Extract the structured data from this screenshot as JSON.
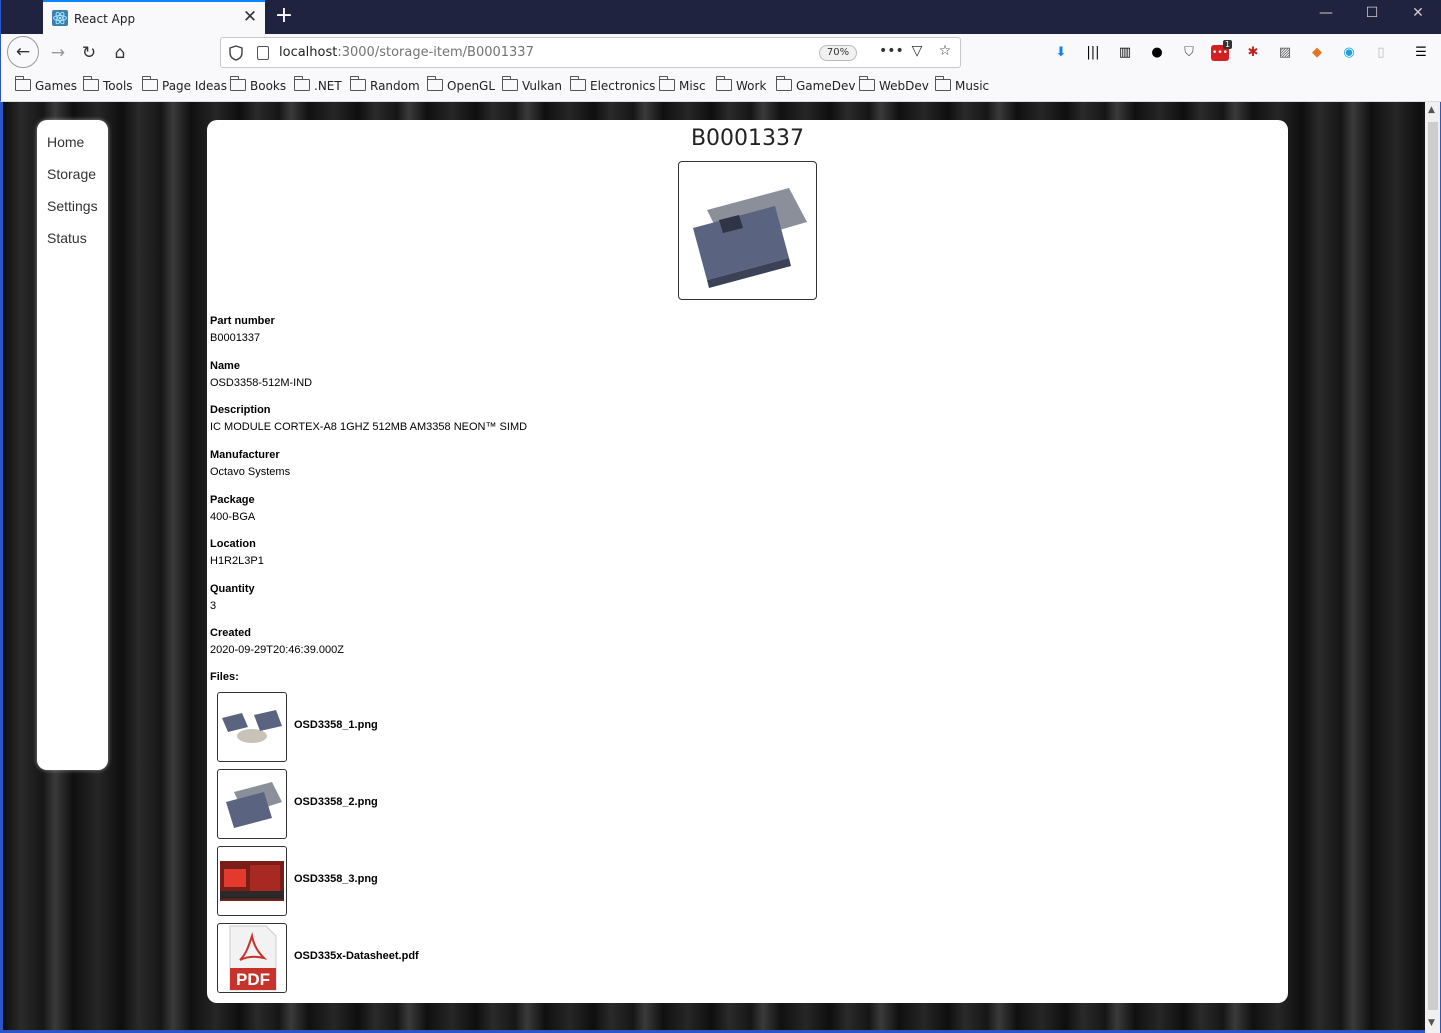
{
  "browser": {
    "tab_title": "React App",
    "url_host": "localhost",
    "url_rest": ":3000/storage-item/B0001337",
    "zoom": "70%",
    "notification_badge": "1",
    "bookmarks": [
      "Games",
      "Tools",
      "Page Ideas",
      "Books",
      ".NET",
      "Random",
      "OpenGL",
      "Vulkan",
      "Electronics",
      "Misc",
      "Work",
      "GameDev",
      "WebDev",
      "Music"
    ]
  },
  "sidenav": {
    "items": [
      "Home",
      "Storage",
      "Settings",
      "Status"
    ]
  },
  "item": {
    "heading": "B0001337",
    "fields": [
      {
        "label": "Part number",
        "value": "B0001337"
      },
      {
        "label": "Name",
        "value": "OSD3358-512M-IND"
      },
      {
        "label": "Description",
        "value": "IC MODULE CORTEX-A8 1GHZ 512MB AM3358 NEON™ SIMD"
      },
      {
        "label": "Manufacturer",
        "value": "Octavo Systems"
      },
      {
        "label": "Package",
        "value": "400-BGA"
      },
      {
        "label": "Location",
        "value": "H1R2L3P1"
      },
      {
        "label": "Quantity",
        "value": "3"
      },
      {
        "label": "Created",
        "value": "2020-09-29T20:46:39.000Z"
      }
    ],
    "files_label": "Files:",
    "files": [
      "OSD3358_1.png",
      "OSD3358_2.png",
      "OSD3358_3.png",
      "OSD335x-Datasheet.pdf"
    ],
    "pdf_badge": "PDF"
  },
  "colors": {
    "titlebar": "#202340",
    "tab_accent": "#0a84ff",
    "pdf_red": "#c5332a",
    "chip": "#5a6481"
  }
}
